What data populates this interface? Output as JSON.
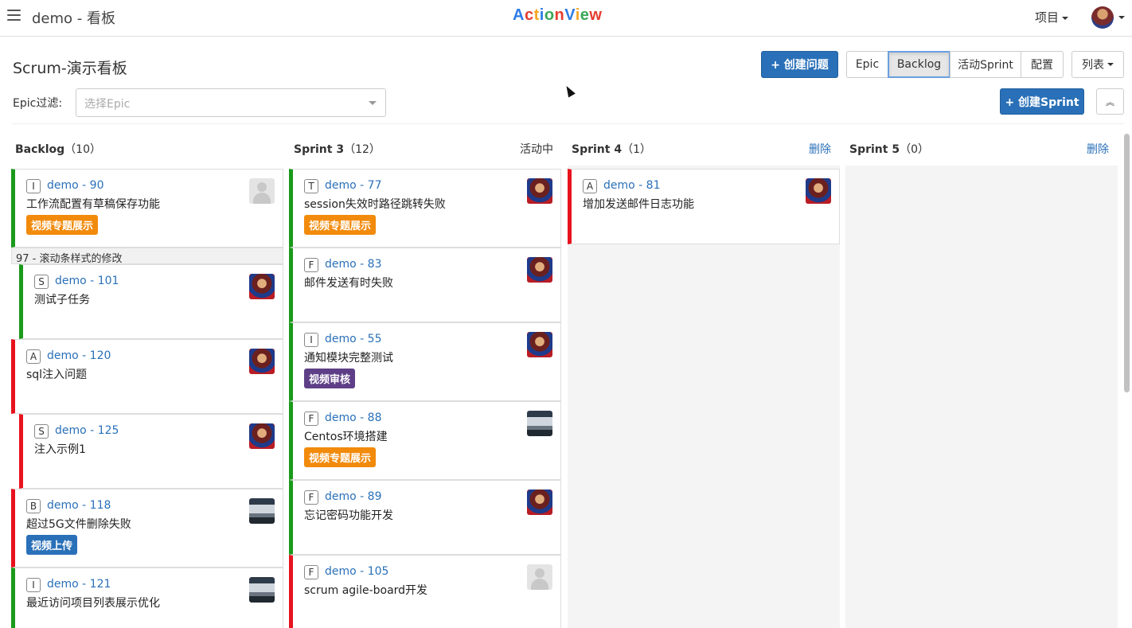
{
  "topbar": {
    "menu_icon": "hamburger-icon",
    "title": "demo - 看板",
    "logo": {
      "part1": "A",
      "part2": "c",
      "part3": "t",
      "part4": "i",
      "part5": "o",
      "part6": "n",
      "part7": "V",
      "part8": "i",
      "part9": "e",
      "part10": "w"
    },
    "project_menu": "项目"
  },
  "header": {
    "board_title": "Scrum-演示看板",
    "create_issue": "+ 创建问题",
    "views": {
      "epic": "Epic",
      "backlog": "Backlog",
      "active_sprint": "活动Sprint",
      "config": "配置"
    },
    "list_menu": "列表",
    "filter_label": "Epic过滤:",
    "epic_placeholder": "选择Epic",
    "create_sprint": "+ 创建Sprint",
    "collapse_icon": "double-chevron-up-icon",
    "selected_view": "Backlog"
  },
  "columns": [
    {
      "name": "Backlog",
      "count": "（10）",
      "action": ""
    },
    {
      "name": "Sprint 3",
      "count": "（12）",
      "status": "活动中"
    },
    {
      "name": "Sprint 4",
      "count": "（1）",
      "action": "删除"
    },
    {
      "name": "Sprint 5",
      "count": "（0）",
      "action": "删除"
    }
  ],
  "backlog": {
    "card1": {
      "type": "I",
      "key": "demo - 90",
      "summary": "工作流配置有草稿保存功能",
      "label": "视频专题展示"
    },
    "subgroup": "97 - 滚动条样式的修改",
    "card2": {
      "type": "S",
      "key": "demo - 101",
      "summary": "测试子任务"
    },
    "card3": {
      "type": "A",
      "key": "demo - 120",
      "summary": "sql注入问题"
    },
    "card4": {
      "type": "S",
      "key": "demo - 125",
      "summary": "注入示例1"
    },
    "card5": {
      "type": "B",
      "key": "demo - 118",
      "summary": "超过5G文件删除失败",
      "label": "视频上传"
    },
    "card6": {
      "type": "I",
      "key": "demo - 121",
      "summary": "最近访问项目列表展示优化"
    }
  },
  "sprint3": {
    "card1": {
      "type": "T",
      "key": "demo - 77",
      "summary": "session失效时路径跳转失败",
      "label": "视频专题展示"
    },
    "card2": {
      "type": "F",
      "key": "demo - 83",
      "summary": "邮件发送有时失败"
    },
    "card3": {
      "type": "I",
      "key": "demo - 55",
      "summary": "通知模块完整测试",
      "label": "视频审核"
    },
    "card4": {
      "type": "F",
      "key": "demo - 88",
      "summary": "Centos环境搭建",
      "label": "视频专题展示"
    },
    "card5": {
      "type": "F",
      "key": "demo - 89",
      "summary": "忘记密码功能开发"
    },
    "card6": {
      "type": "F",
      "key": "demo - 105",
      "summary": "scrum agile-board开发"
    }
  },
  "sprint4": {
    "card1": {
      "type": "A",
      "key": "demo - 81",
      "summary": "增加发送邮件日志功能"
    }
  },
  "colors": {
    "primary": "#2a70b8",
    "priority_green": "#1a9a1a",
    "priority_red": "#e8121e",
    "label_orange": "#f28a0c",
    "label_purple": "#5e3f87",
    "label_blue": "#2a70b8",
    "column_bg": "#f4f4f4"
  }
}
